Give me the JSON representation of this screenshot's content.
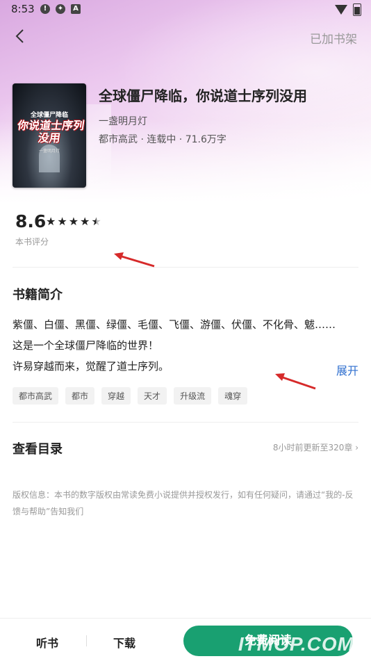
{
  "status_bar": {
    "time": "8:53"
  },
  "nav": {
    "added_to_shelf": "已加书架"
  },
  "book": {
    "title": "全球僵尸降临，你说道士序列没用",
    "author": "一盏明月灯",
    "meta": "都市高武 · 连载中 · 71.6万字",
    "cover": {
      "top_text": "全球僵尸降临",
      "main_text": "你说道士序列没用",
      "author_small": "一盏明月灯"
    }
  },
  "rating": {
    "score": "8.6",
    "stars": 4.5,
    "label": "本书评分"
  },
  "intro": {
    "title": "书籍简介",
    "lines": [
      "紫僵、白僵、黑僵、绿僵、毛僵、飞僵、游僵、伏僵、不化骨、魃……",
      "这是一个全球僵尸降临的世界！",
      "许易穿越而来，觉醒了道士序列。"
    ],
    "expand": "展开",
    "tags": [
      "都市高武",
      "都市",
      "穿越",
      "天才",
      "升级流",
      "魂穿"
    ]
  },
  "catalog": {
    "title": "查看目录",
    "update_info": "8小时前更新至320章"
  },
  "copyright": "版权信息：本书的数字版权由常读免费小说提供并授权发行，如有任何疑问，请通过“我的-反馈与帮助”告知我们",
  "bottom_bar": {
    "listen": "听书",
    "download": "下载",
    "read_free": "免费阅读"
  },
  "watermark": "ITMOP.COM",
  "colors": {
    "accent_green": "#19a071",
    "link_blue": "#2f6fcf",
    "annotation_red": "#d62a2a"
  }
}
